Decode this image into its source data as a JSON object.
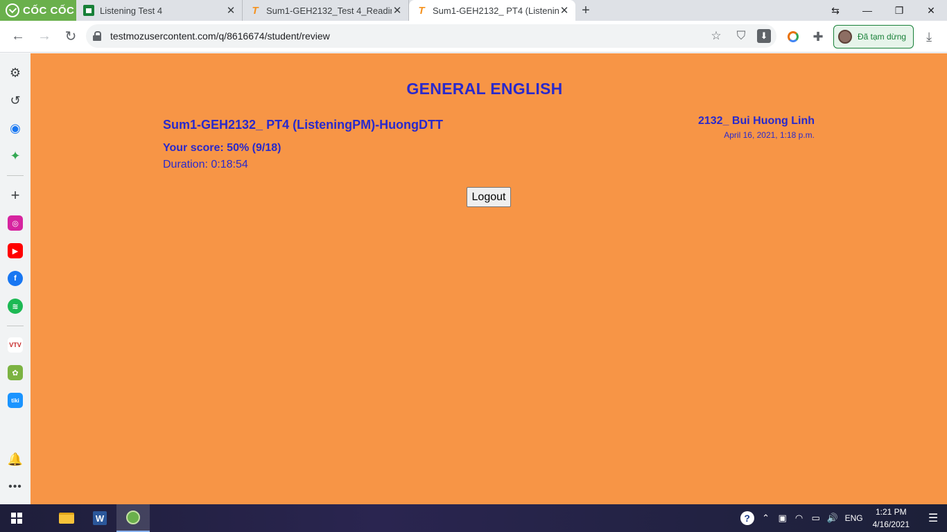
{
  "browser": {
    "brand": "CỐC CỐC",
    "tabs": [
      {
        "title": "Listening Test 4",
        "favicon": "sheets-icon"
      },
      {
        "title": "Sum1-GEH2132_Test 4_Readin",
        "favicon": "testmoz-icon"
      },
      {
        "title": "Sum1-GEH2132_ PT4 (Listenin",
        "favicon": "testmoz-icon",
        "active": true
      }
    ],
    "url": "testmozusercontent.com/q/8616674/student/review",
    "profile_status": "Đã tạm dừng"
  },
  "page": {
    "heading": "GENERAL ENGLISH",
    "quiz_name": "Sum1-GEH2132_ PT4 (ListeningPM)-HuongDTT",
    "score": "Your score: 50% (9/18)",
    "duration": "Duration: 0:18:54",
    "student_name": "2132_ Bui Huong Linh",
    "submitted_at": "April 16, 2021, 1:18 p.m.",
    "logout_label": "Logout",
    "background_color": "#f79546",
    "text_color": "#2929cc"
  },
  "taskbar": {
    "language": "ENG",
    "time": "1:21 PM",
    "date": "4/16/2021"
  }
}
